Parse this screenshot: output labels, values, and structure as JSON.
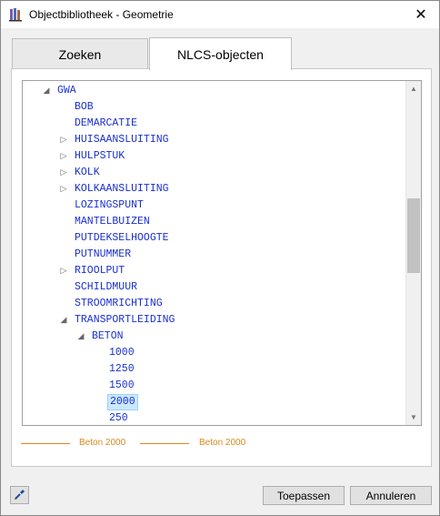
{
  "window": {
    "title": "Objectbibliotheek - Geometrie",
    "close_glyph": "✕",
    "app_icon": "library-books-icon",
    "colors": {
      "tree_text": "#1a2fd0",
      "legend": "#d98a1e",
      "selection": "#cce8ff"
    }
  },
  "tabs": [
    {
      "label": "Zoeken",
      "active": false
    },
    {
      "label": "NLCS-objecten",
      "active": true
    }
  ],
  "tree": {
    "items": [
      {
        "label": "GWA",
        "expander": "◢",
        "level": 0,
        "selected": false
      },
      {
        "label": "BOB",
        "expander": "",
        "level": 1,
        "selected": false
      },
      {
        "label": "DEMARCATIE",
        "expander": "",
        "level": 1,
        "selected": false
      },
      {
        "label": "HUISAANSLUITING",
        "expander": "▷",
        "level": 1,
        "selected": false
      },
      {
        "label": "HULPSTUK",
        "expander": "▷",
        "level": 1,
        "selected": false
      },
      {
        "label": "KOLK",
        "expander": "▷",
        "level": 1,
        "selected": false
      },
      {
        "label": "KOLKAANSLUITING",
        "expander": "▷",
        "level": 1,
        "selected": false
      },
      {
        "label": "LOZINGSPUNT",
        "expander": "",
        "level": 1,
        "selected": false
      },
      {
        "label": "MANTELBUIZEN",
        "expander": "",
        "level": 1,
        "selected": false
      },
      {
        "label": "PUTDEKSELHOOGTE",
        "expander": "",
        "level": 1,
        "selected": false
      },
      {
        "label": "PUTNUMMER",
        "expander": "",
        "level": 1,
        "selected": false
      },
      {
        "label": "RIOOLPUT",
        "expander": "▷",
        "level": 1,
        "selected": false
      },
      {
        "label": "SCHILDMUUR",
        "expander": "",
        "level": 1,
        "selected": false
      },
      {
        "label": "STROOMRICHTING",
        "expander": "",
        "level": 1,
        "selected": false
      },
      {
        "label": "TRANSPORTLEIDING",
        "expander": "◢",
        "level": 1,
        "selected": false
      },
      {
        "label": "BETON",
        "expander": "◢",
        "level": 2,
        "selected": false
      },
      {
        "label": "1000",
        "expander": "",
        "level": 3,
        "selected": false
      },
      {
        "label": "1250",
        "expander": "",
        "level": 3,
        "selected": false
      },
      {
        "label": "1500",
        "expander": "",
        "level": 3,
        "selected": false
      },
      {
        "label": "2000",
        "expander": "",
        "level": 3,
        "selected": true
      },
      {
        "label": "250",
        "expander": "",
        "level": 3,
        "selected": false
      }
    ],
    "scroll": {
      "up_glyph": "▲",
      "down_glyph": "▼"
    }
  },
  "legend": {
    "items": [
      {
        "label": "Beton 2000"
      },
      {
        "label": "Beton 2000"
      }
    ]
  },
  "footer": {
    "pick_icon": "eyedropper-icon",
    "apply_label": "Toepassen",
    "cancel_label": "Annuleren"
  }
}
